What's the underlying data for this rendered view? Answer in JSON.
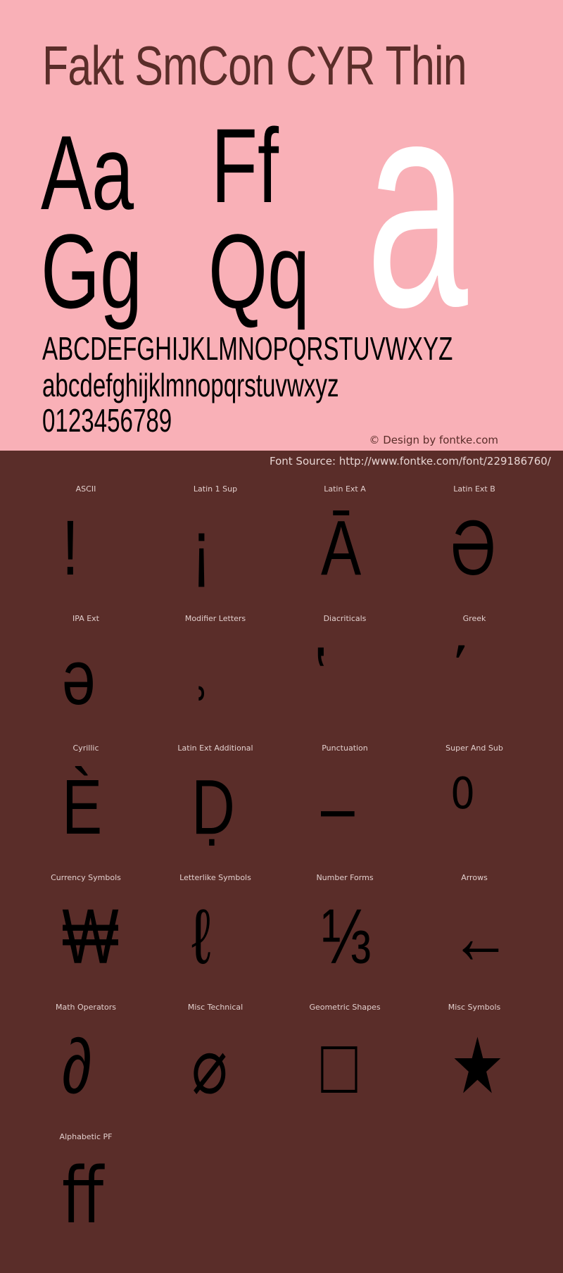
{
  "header": {
    "font_name": "Fakt SmCon CYR Thin",
    "samples": {
      "pair_1": "Aa",
      "pair_2": "Ff",
      "pair_3": "Gg",
      "pair_4": "Qq",
      "big_glyph": "a"
    },
    "alphabet": {
      "uppercase": "ABCDEFGHIJKLMNOPQRSTUVWXYZ",
      "lowercase": "abcdefghijklmnopqrstuvwxyz",
      "digits": "0123456789"
    },
    "credit": "© Design by fontke.com"
  },
  "source_line": "Font Source: http://www.fontke.com/font/229186760/",
  "colors": {
    "hero_background": "#f9b0b7",
    "page_background": "#5a2d29",
    "title_color": "#5a2d29",
    "glyph_color": "#000000",
    "big_glyph_color": "#ffffff",
    "label_color": "#e2cfcd"
  },
  "blocks": [
    {
      "label": "ASCII",
      "glyph": "!"
    },
    {
      "label": "Latin 1 Sup",
      "glyph": "¡"
    },
    {
      "label": "Latin Ext A",
      "glyph": "Ā"
    },
    {
      "label": "Latin Ext B",
      "glyph": "Ə"
    },
    {
      "label": "IPA Ext",
      "glyph": "ə"
    },
    {
      "label": "Modifier Letters",
      "glyph": "˒"
    },
    {
      "label": "Diacriticals",
      "glyph": "̔"
    },
    {
      "label": "Greek",
      "glyph": "΄"
    },
    {
      "label": "Cyrillic",
      "glyph": "Ѐ"
    },
    {
      "label": "Latin Ext Additional",
      "glyph": "Ḍ"
    },
    {
      "label": "Punctuation",
      "glyph": "‒"
    },
    {
      "label": "Super And Sub",
      "glyph": "⁰"
    },
    {
      "label": "Currency Symbols",
      "glyph": "₩"
    },
    {
      "label": "Letterlike Symbols",
      "glyph": "ℓ"
    },
    {
      "label": "Number Forms",
      "glyph": "⅓"
    },
    {
      "label": "Arrows",
      "glyph": "←"
    },
    {
      "label": "Math Operators",
      "glyph": "∂"
    },
    {
      "label": "Misc Technical",
      "glyph": "⌀"
    },
    {
      "label": "Geometric Shapes",
      "glyph": "□"
    },
    {
      "label": "Misc Symbols",
      "glyph": "★"
    },
    {
      "label": "Alphabetic PF",
      "glyph": "ﬀ"
    }
  ]
}
